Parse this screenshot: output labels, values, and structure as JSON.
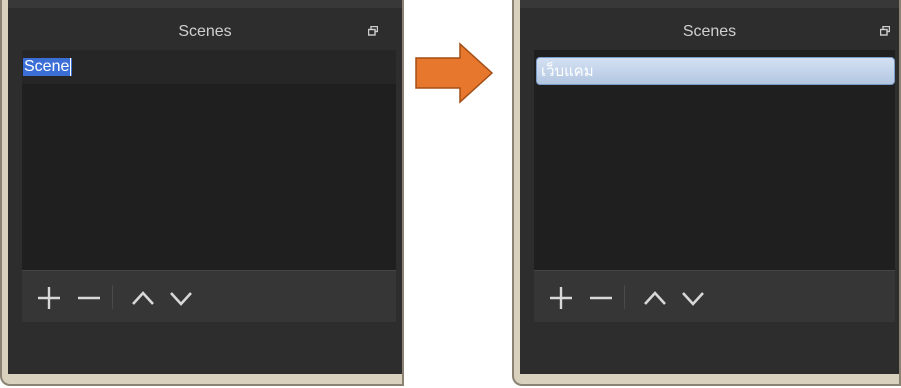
{
  "before": {
    "dock_title": "Scenes",
    "scene_name": "Scene"
  },
  "after": {
    "dock_title": "Scenes",
    "scene_name": "เว็บแคม"
  },
  "toolbar_buttons": [
    "add-icon",
    "remove-icon",
    "move-up-icon",
    "move-down-icon"
  ],
  "colors": {
    "panel_bg": "#2d2d2d",
    "list_bg": "#1f1f1f",
    "selection": "#3b6fd6",
    "arrow": "#e8772e"
  }
}
